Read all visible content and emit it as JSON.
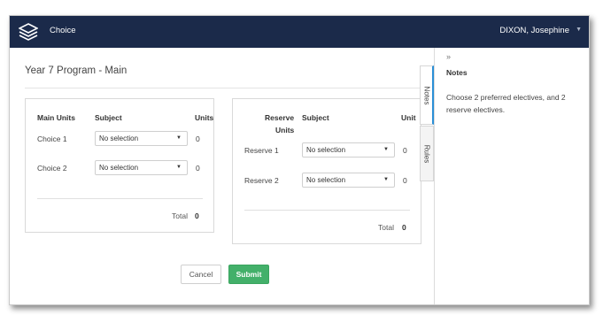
{
  "header": {
    "app_name": "Choice",
    "user_name": "DIXON, Josephine"
  },
  "page": {
    "title": "Year 7 Program - Main"
  },
  "main_units": {
    "col_units_label": "Main Units",
    "col_subject": "Subject",
    "col_units": "Units",
    "rows": [
      {
        "label": "Choice 1",
        "value": "No selection",
        "units": "0"
      },
      {
        "label": "Choice 2",
        "value": "No selection",
        "units": "0"
      }
    ],
    "total_label": "Total",
    "total_value": "0"
  },
  "reserve_units": {
    "col_units_label_line1": "Reserve",
    "col_units_label_line2": "Units",
    "col_subject": "Subject",
    "col_units": "Unit",
    "rows": [
      {
        "label": "Reserve 1",
        "value": "No selection",
        "units": "0"
      },
      {
        "label": "Reserve 2",
        "value": "No selection",
        "units": "0"
      }
    ],
    "total_label": "Total",
    "total_value": "0"
  },
  "actions": {
    "cancel": "Cancel",
    "submit": "Submit"
  },
  "side_tabs": [
    "Notes",
    "Rules"
  ],
  "notes_panel": {
    "collapse_glyph": "»",
    "title": "Notes",
    "text": "Choose 2 preferred electives, and 2 reserve electives."
  },
  "icons": [
    "stack-logo-icon",
    "chevron-down-icon",
    "collapse-panel-icon"
  ],
  "colors": {
    "header_bg": "#1b2a4a",
    "submit_bg": "#43b06a",
    "active_tab": "#2b8fd6"
  }
}
